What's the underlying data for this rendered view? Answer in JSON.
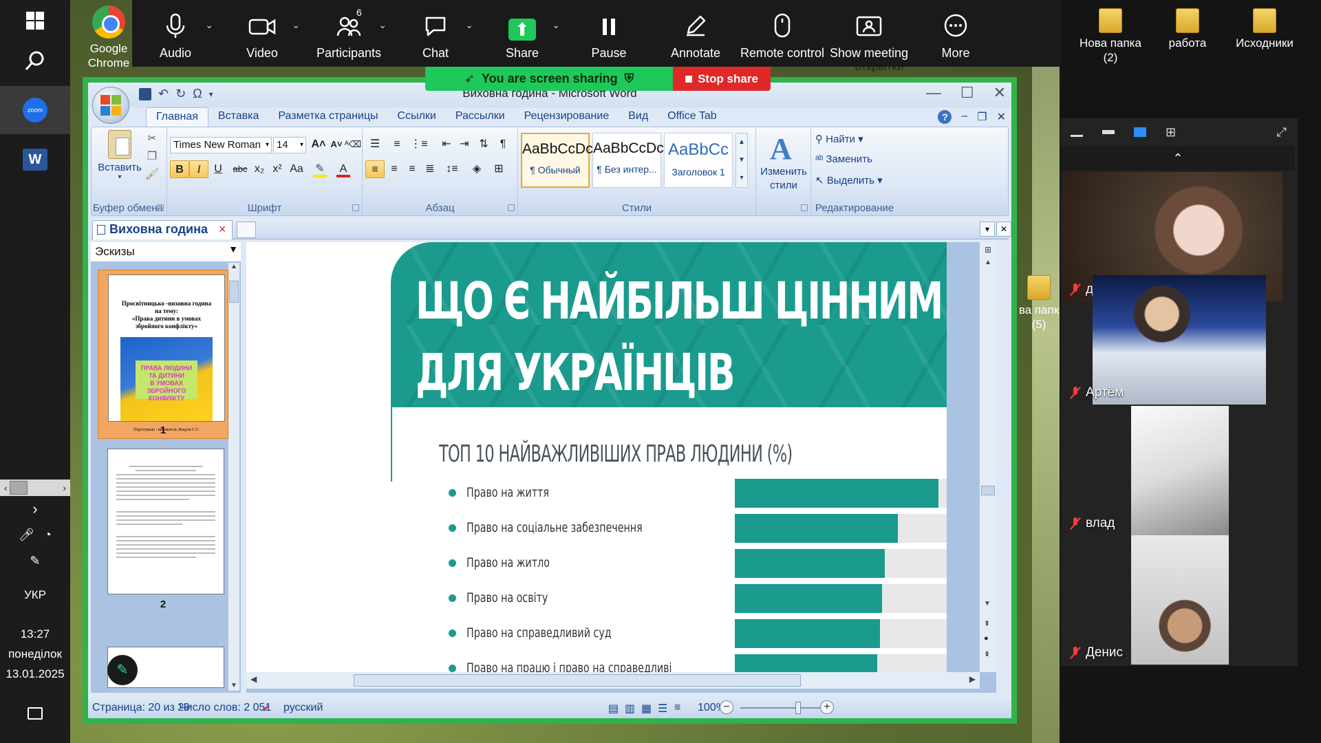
{
  "taskbar": {
    "language": "УКР",
    "time": "13:27",
    "day": "понеділок",
    "date": "13.01.2025"
  },
  "zoom_toolbar": {
    "items": [
      {
        "label": "Audio",
        "icon": "microphone-icon"
      },
      {
        "label": "Video",
        "icon": "camera-icon"
      },
      {
        "label": "Participants",
        "icon": "participants-icon",
        "badge": "6"
      },
      {
        "label": "Chat",
        "icon": "chat-icon"
      },
      {
        "label": "Share",
        "icon": "share-arrow-icon"
      },
      {
        "label": "Pause",
        "icon": "pause-icon"
      },
      {
        "label": "Annotate",
        "icon": "pencil-icon"
      },
      {
        "label": "Remote control",
        "icon": "mouse-icon"
      },
      {
        "label": "Show meeting",
        "icon": "window-person-icon"
      },
      {
        "label": "More",
        "icon": "ellipsis-icon"
      }
    ],
    "share_banner": "You are screen sharing",
    "stop_share": "Stop share",
    "accent_green": "#1ec85a",
    "stop_red": "#e02828"
  },
  "desktop_icons": {
    "chrome_line1": "Google",
    "chrome_line2": "Chrome",
    "folder1_line1": "Нова папка",
    "folder1_line2": "(2)",
    "folder2": "работа",
    "folder3": "Исходники",
    "folder4_line1": "ва папк",
    "folder4_line2": "(5)",
    "overlap_label": "открытки"
  },
  "word": {
    "title": "Виховна година - Microsoft Word",
    "tabs": [
      "Главная",
      "Вставка",
      "Разметка страницы",
      "Ссылки",
      "Рассылки",
      "Рецензирование",
      "Вид",
      "Office Tab"
    ],
    "active_tab": "Главная",
    "ribbon": {
      "clipboard_group": "Буфер обмена",
      "paste_label": "Вставить",
      "font_group": "Шрифт",
      "font_name": "Times New Roman",
      "font_size": "14",
      "paragraph_group": "Абзац",
      "styles_group": "Стили",
      "editing_group": "Редактирование",
      "styles": [
        {
          "sample": "AaBbCcDc",
          "name": "¶ Обычный"
        },
        {
          "sample": "AaBbCcDc",
          "name": "¶ Без интер..."
        },
        {
          "sample": "AaBbCc",
          "name": "Заголовок 1"
        }
      ],
      "change_styles_line1": "Изменить",
      "change_styles_line2": "стили",
      "find": "Найти",
      "replace": "Заменить",
      "select": "Выделить"
    },
    "doc_tab": "Виховна година",
    "thumbnails_label": "Эскизы",
    "thumb1": {
      "title_line1": "Просвітницько -виховна година",
      "title_line2": "на тему:",
      "title_line3": "«Права дитини в умовах",
      "title_line4": "збройного конфлікту»",
      "flag_line1": "ПРАВА ЛЮДИНИ",
      "flag_line2": "ТА ДИТИНИ",
      "flag_line3": "В УМОВАХ",
      "flag_line4": "ЗБРОЙНОГО КОНФЛІКТУ",
      "footer": "Підготувала : вихователь Вацула С.С.",
      "number": "1"
    },
    "thumb2_number": "2",
    "page": {
      "headline_line1": "ЩО Є НАЙБІЛЬШ ЦІННИМ",
      "headline_line2": "ДЛЯ УКРАЇНЦІВ",
      "teal": "#1a9b8d"
    },
    "chart_data": {
      "type": "bar",
      "title": "ТОП 10 НАЙВАЖЛИВІШИХ ПРАВ ЛЮДИНИ (%)",
      "categories": [
        "Право на життя",
        "Право на соціальне забезпечення",
        "Право на житло",
        "Право на освіту",
        "Право на справедливий суд",
        "Право на працю і право на справедливі"
      ],
      "values": [
        80,
        64,
        59,
        58,
        57,
        56
      ],
      "xlim": [
        0,
        100
      ],
      "grid": false,
      "legend": "none"
    },
    "status": {
      "page": "Страница: 20 из 29",
      "words": "Число слов: 2 051",
      "language": "русский",
      "zoom": "100%"
    }
  },
  "participants": [
    {
      "name": "даша"
    },
    {
      "name": "Артём"
    },
    {
      "name": "влад"
    },
    {
      "name": "Денис"
    }
  ]
}
